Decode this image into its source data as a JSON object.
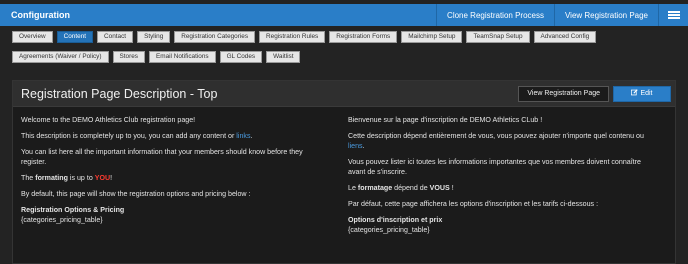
{
  "topbar": {
    "title": "Configuration",
    "clone_label": "Clone Registration Process",
    "view_label": "View Registration Page",
    "menu_icon": "hamburger-icon"
  },
  "tabs": {
    "row1": [
      "Overview",
      "Content",
      "Contact",
      "Styling",
      "Registration Categories",
      "Registration Rules",
      "Registration Forms",
      "Mailchimp Setup",
      "TeamSnap Setup",
      "Advanced Config"
    ],
    "row2": [
      "Agreements (Waiver / Policy)",
      "Stores",
      "Email Notifications",
      "GL Codes",
      "Waitlist"
    ],
    "active": "Content"
  },
  "panel": {
    "title": "Registration Page Description - Top",
    "view_button": "View Registration Page",
    "edit_button": "Edit",
    "edit_icon": "edit-icon"
  },
  "english": {
    "p1": "Welcome to the DEMO Athletics Club registration page!",
    "p2_pre": "This description is completely up to you, you can add any content or ",
    "p2_link": "links",
    "p2_post": ".",
    "p3": "You can list here all the important information that your members should know before they register.",
    "p4_pre": "The ",
    "p4_bold": "formating",
    "p4_mid": " is up to ",
    "p4_red": "YOU",
    "p4_post": "!",
    "p5": "By default, this page will show the registration options and pricing below :",
    "p6_bold": "Registration Options & Pricing",
    "p6_code": "{categories_pricing_table}"
  },
  "french": {
    "p1": "Bienvenue sur la page d'inscription de DEMO Athletics CLub !",
    "p2_pre": "Cette description dépend entièrement de vous, vous pouvez ajouter n'importe quel contenu ou ",
    "p2_link": "liens",
    "p2_post": ".",
    "p3": "Vous pouvez lister ici toutes les informations importantes que vos membres doivent connaître avant de s'inscrire.",
    "p4_pre": "Le ",
    "p4_bold": "formatage",
    "p4_mid": " dépend de ",
    "p4_bold2": "VOUS",
    "p4_post": " !",
    "p5": "Par défaut, cette page affichera les options d'inscription et les tarifs ci-dessous :",
    "p6_bold": "Options d'inscription et prix",
    "p6_code": "{categories_pricing_table}"
  }
}
